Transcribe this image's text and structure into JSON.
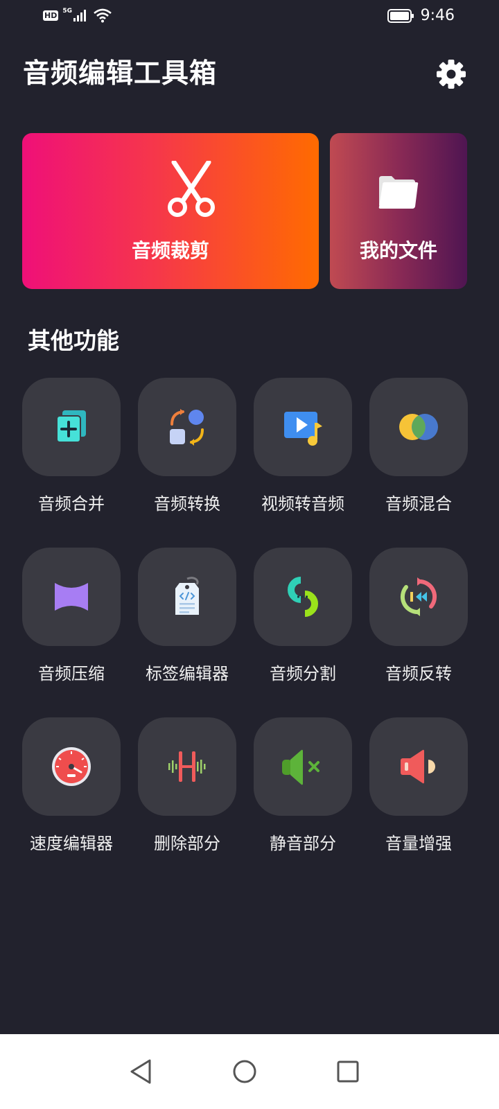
{
  "status_bar": {
    "hd": "HD",
    "network": "5G",
    "time": "9:46"
  },
  "header": {
    "title": "音频编辑工具箱",
    "settings_icon": "gear-icon"
  },
  "hero": {
    "trim_label": "音频裁剪",
    "files_label": "我的文件",
    "trim_icon": "scissors-icon",
    "files_icon": "folder-icon"
  },
  "section": {
    "title": "其他功能"
  },
  "tools": [
    {
      "label": "音频合并",
      "icon": "merge-icon"
    },
    {
      "label": "音频转换",
      "icon": "convert-icon"
    },
    {
      "label": "视频转音频",
      "icon": "video-to-audio-icon"
    },
    {
      "label": "音频混合",
      "icon": "mix-icon"
    },
    {
      "label": "音频压缩",
      "icon": "compress-icon"
    },
    {
      "label": "标签编辑器",
      "icon": "tag-editor-icon"
    },
    {
      "label": "音频分割",
      "icon": "split-icon"
    },
    {
      "label": "音频反转",
      "icon": "reverse-icon"
    },
    {
      "label": "速度编辑器",
      "icon": "speedometer-icon"
    },
    {
      "label": "删除部分",
      "icon": "delete-part-icon"
    },
    {
      "label": "静音部分",
      "icon": "mute-icon"
    },
    {
      "label": "音量增强",
      "icon": "volume-boost-icon"
    }
  ],
  "colors": {
    "background": "#22222d",
    "tile": "#3a3a42",
    "trim_gradient_start": "#ef1078",
    "trim_gradient_end": "#ff6b00",
    "files_gradient_start": "#c04a52",
    "files_gradient_end": "#4f1552"
  }
}
